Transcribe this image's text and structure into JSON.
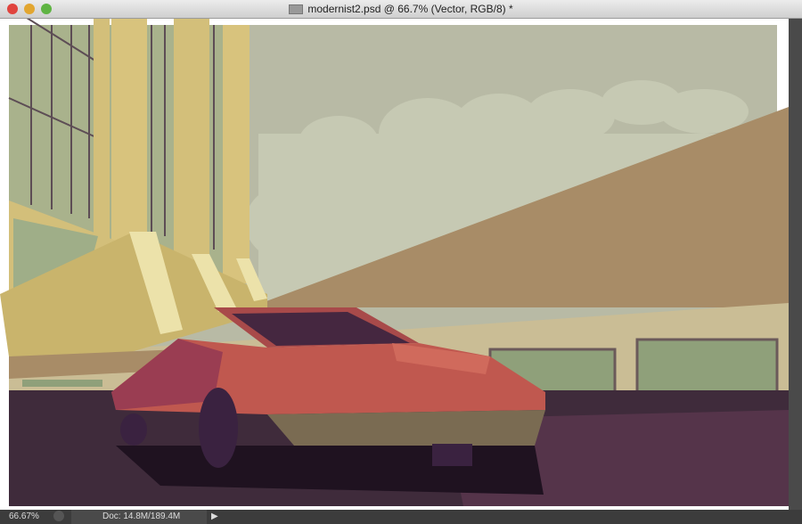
{
  "window": {
    "title": "modernist2.psd @ 66.7% (Vector, RGB/8) *"
  },
  "status": {
    "zoom": "66.67%",
    "doc_info": "Doc: 14.8M/189.4M"
  },
  "colors": {
    "sky": "#b8baa5",
    "cloud": "#c6c9b3",
    "wall": "#a88c67",
    "beige": "#cabd95",
    "building": "#d3bf7a",
    "ground": "#3f2b3b",
    "car": "#c0584f"
  }
}
